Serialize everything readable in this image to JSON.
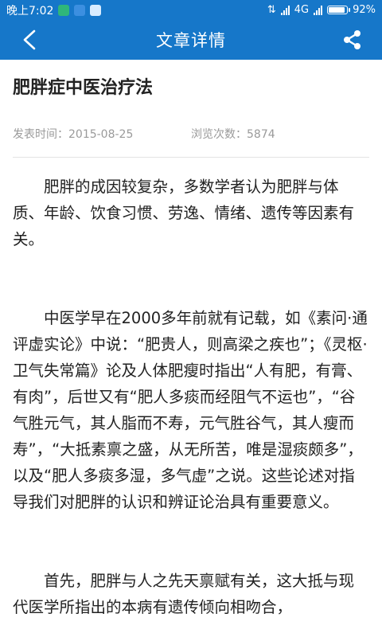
{
  "status_bar": {
    "time": "晚上7:02",
    "network": "4G",
    "battery_percent": "92%",
    "battery_level": 0.92
  },
  "app_bar": {
    "title": "文章详情"
  },
  "article": {
    "title": "肥胖症中医治疗法",
    "published_label": "发表时间：2015-08-25",
    "views_label": "浏览次数：5874",
    "paragraphs": [
      "肥胖的成因较复杂，多数学者认为肥胖与体质、年龄、饮食习惯、劳逸、情绪、遗传等因素有关。",
      "中医学早在2000多年前就有记载，如《素问·通评虚实论》中说：“肥贵人，则高梁之疾也”；《灵枢·卫气失常篇》论及人体肥瘦时指出“人有肥，有膏、有肉”，后世又有“肥人多痰而经阻气不运也”，“谷气胜元气，其人脂而不寿，元气胜谷气，其人瘦而寿”，“大抵素禀之盛，从无所苦，唯是湿痰颇多”，以及“肥人多痰多湿，多气虚”之说。这些论述对指导我们对肥胖的认识和辨证论治具有重要意义。",
      "首先，肥胖与人之先天禀赋有关，这大抵与现代医学所指出的本病有遗传倾向相吻合，"
    ]
  },
  "colors": {
    "primary": "#1677c9",
    "text": "#222222",
    "meta": "#9a9a9a",
    "divider": "#e4e4e4"
  },
  "icons": {
    "back": "chevron-left-icon",
    "share": "share-icon"
  }
}
